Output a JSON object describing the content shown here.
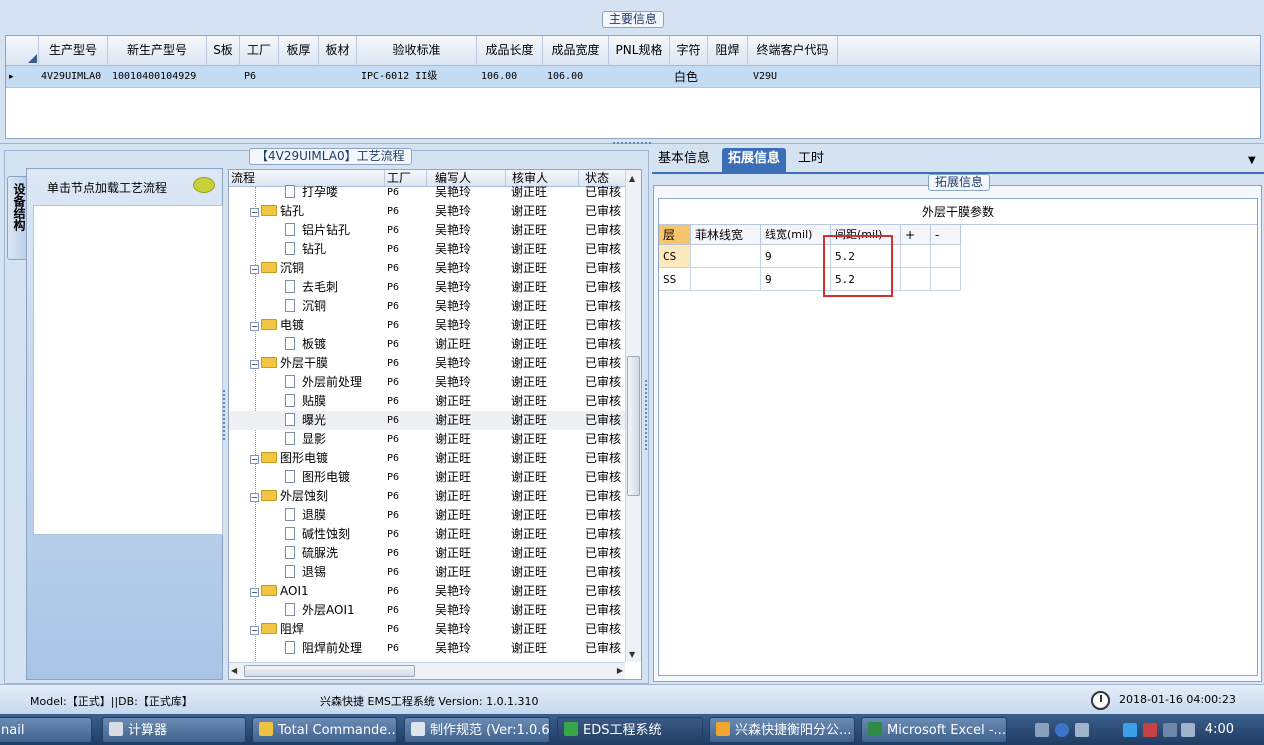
{
  "main": {
    "panel_title": "主要信息",
    "columns": [
      "生产型号",
      "新生产型号",
      "S板",
      "工厂",
      "板厚",
      "板材",
      "验收标准",
      "成品长度",
      "成品宽度",
      "PNL规格",
      "字符",
      "阻焊",
      "终端客户代码"
    ],
    "row": {
      "marker": "▸",
      "生产型号": "4V29UIMLA0",
      "新生产型号": "10010400104929",
      "S板": "",
      "工厂": "P6",
      "板厚": "",
      "板材": "",
      "验收标准": "IPC-6012 II级",
      "成品长度": "106.00",
      "成品宽度": "106.00",
      "PNL规格": "",
      "字符": "白色",
      "阻焊": "",
      "终端客户代码": "V29U"
    }
  },
  "process": {
    "panel_title": "【4V29UIMLA0】工艺流程",
    "vtab_label": "设备结构",
    "left_hint": "单击节点加载工艺流程",
    "columns": [
      "流程",
      "工厂",
      "编写人",
      "核审人",
      "状态"
    ],
    "rows": [
      {
        "type": "leaf",
        "name": "打孕喽",
        "factory": "P6",
        "writer": "吴艳玲",
        "checker": "谢正旺",
        "status": "已审核"
      },
      {
        "type": "folder",
        "name": "钻孔",
        "factory": "P6",
        "writer": "吴艳玲",
        "checker": "谢正旺",
        "status": "已审核"
      },
      {
        "type": "leaf",
        "name": "铝片钻孔",
        "factory": "P6",
        "writer": "吴艳玲",
        "checker": "谢正旺",
        "status": "已审核"
      },
      {
        "type": "leaf",
        "name": "钻孔",
        "factory": "P6",
        "writer": "吴艳玲",
        "checker": "谢正旺",
        "status": "已审核"
      },
      {
        "type": "folder",
        "name": "沉铜",
        "factory": "P6",
        "writer": "吴艳玲",
        "checker": "谢正旺",
        "status": "已审核"
      },
      {
        "type": "leaf",
        "name": "去毛刺",
        "factory": "P6",
        "writer": "吴艳玲",
        "checker": "谢正旺",
        "status": "已审核"
      },
      {
        "type": "leaf",
        "name": "沉铜",
        "factory": "P6",
        "writer": "吴艳玲",
        "checker": "谢正旺",
        "status": "已审核"
      },
      {
        "type": "folder",
        "name": "电镀",
        "factory": "P6",
        "writer": "吴艳玲",
        "checker": "谢正旺",
        "status": "已审核"
      },
      {
        "type": "leaf",
        "name": "板镀",
        "factory": "P6",
        "writer": "谢正旺",
        "checker": "谢正旺",
        "status": "已审核"
      },
      {
        "type": "folder",
        "name": "外层干膜",
        "factory": "P6",
        "writer": "吴艳玲",
        "checker": "谢正旺",
        "status": "已审核"
      },
      {
        "type": "leaf",
        "name": "外层前处理",
        "factory": "P6",
        "writer": "吴艳玲",
        "checker": "谢正旺",
        "status": "已审核"
      },
      {
        "type": "leaf",
        "name": "贴膜",
        "factory": "P6",
        "writer": "谢正旺",
        "checker": "谢正旺",
        "status": "已审核"
      },
      {
        "type": "leaf",
        "name": "曝光",
        "factory": "P6",
        "writer": "谢正旺",
        "checker": "谢正旺",
        "status": "已审核",
        "selected": true
      },
      {
        "type": "leaf",
        "name": "显影",
        "factory": "P6",
        "writer": "谢正旺",
        "checker": "谢正旺",
        "status": "已审核"
      },
      {
        "type": "folder",
        "name": "图形电镀",
        "factory": "P6",
        "writer": "谢正旺",
        "checker": "谢正旺",
        "status": "已审核"
      },
      {
        "type": "leaf",
        "name": "图形电镀",
        "factory": "P6",
        "writer": "谢正旺",
        "checker": "谢正旺",
        "status": "已审核"
      },
      {
        "type": "folder",
        "name": "外层蚀刻",
        "factory": "P6",
        "writer": "谢正旺",
        "checker": "谢正旺",
        "status": "已审核"
      },
      {
        "type": "leaf",
        "name": "退膜",
        "factory": "P6",
        "writer": "谢正旺",
        "checker": "谢正旺",
        "status": "已审核"
      },
      {
        "type": "leaf",
        "name": "碱性蚀刻",
        "factory": "P6",
        "writer": "谢正旺",
        "checker": "谢正旺",
        "status": "已审核"
      },
      {
        "type": "leaf",
        "name": "硫脲洗",
        "factory": "P6",
        "writer": "谢正旺",
        "checker": "谢正旺",
        "status": "已审核"
      },
      {
        "type": "leaf",
        "name": "退锡",
        "factory": "P6",
        "writer": "谢正旺",
        "checker": "谢正旺",
        "status": "已审核"
      },
      {
        "type": "folder",
        "name": "AOI1",
        "factory": "P6",
        "writer": "吴艳玲",
        "checker": "谢正旺",
        "status": "已审核"
      },
      {
        "type": "leaf",
        "name": "外层AOI1",
        "factory": "P6",
        "writer": "吴艳玲",
        "checker": "谢正旺",
        "status": "已审核"
      },
      {
        "type": "folder",
        "name": "阻焊",
        "factory": "P6",
        "writer": "吴艳玲",
        "checker": "谢正旺",
        "status": "已审核"
      },
      {
        "type": "leaf",
        "name": "阻焊前处理",
        "factory": "P6",
        "writer": "吴艳玲",
        "checker": "谢正旺",
        "status": "已审核"
      }
    ]
  },
  "right": {
    "tabs": [
      "基本信息",
      "拓展信息",
      "工时"
    ],
    "active_tab": "拓展信息",
    "frame_title": "拓展信息",
    "grid_caption": "外层干膜参数",
    "columns": [
      "层",
      "菲林线宽",
      "线宽(mil)",
      "间距(mil)",
      "+",
      "-"
    ],
    "rows": [
      {
        "层": "CS",
        "菲林线宽": "",
        "线宽(mil)": "9",
        "间距(mil)": "5.2"
      },
      {
        "层": "SS",
        "菲林线宽": "",
        "线宽(mil)": "9",
        "间距(mil)": "5.2"
      }
    ]
  },
  "status": {
    "model": "Model:【正式】||DB:【正式库】",
    "app": "兴森快捷 EMS工程系统 Version: 1.0.1.310",
    "datetime": "2018-01-16 04:00:23"
  },
  "taskbar": {
    "items": [
      {
        "label": "nail",
        "color": "#ffffff"
      },
      {
        "label": "计算器",
        "color": "#d9dde3"
      },
      {
        "label": "Total Commande...",
        "color": "#f0c040"
      },
      {
        "label": "制作规范 (Ver:1.0.6)",
        "color": "#dfe6ee"
      },
      {
        "label": "EDS工程系统",
        "color": "#3aa64a"
      },
      {
        "label": "兴森快捷衡阳分公...",
        "color": "#f2a530"
      },
      {
        "label": "Microsoft Excel -...",
        "color": "#2e8b46"
      }
    ],
    "time": "4:00"
  }
}
